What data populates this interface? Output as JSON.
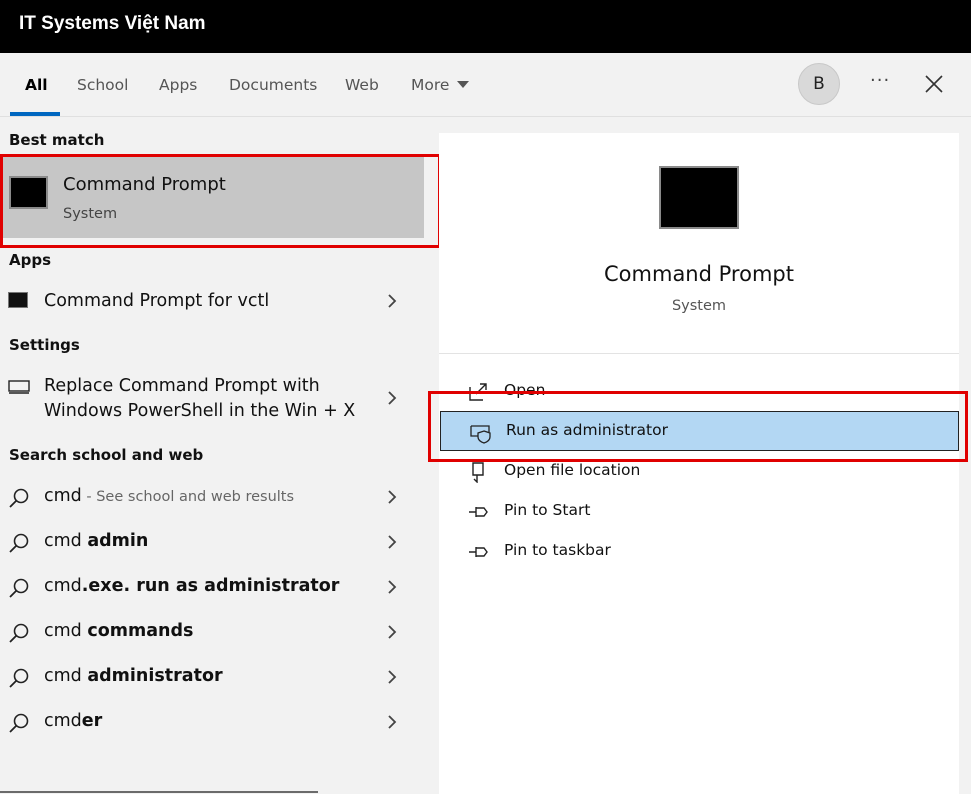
{
  "window": {
    "title": "IT Systems Việt Nam"
  },
  "tabs": [
    {
      "label": "All"
    },
    {
      "label": "School"
    },
    {
      "label": "Apps"
    },
    {
      "label": "Documents"
    },
    {
      "label": "Web"
    },
    {
      "label": "More"
    }
  ],
  "header": {
    "avatar_initial": "B",
    "more_dots": "···"
  },
  "left": {
    "best_match_heading": "Best match",
    "best_match": {
      "name": "Command Prompt",
      "type": "System"
    },
    "apps_heading": "Apps",
    "apps": [
      {
        "label": "Command Prompt for vctl"
      }
    ],
    "settings_heading": "Settings",
    "settings": [
      {
        "line1": "Replace Command Prompt with",
        "line2": "Windows PowerShell in the Win + X"
      }
    ],
    "web_heading": "Search school and web",
    "web_results": [
      {
        "prefix": "cmd",
        "bold": "",
        "suffix": " - See school and web results"
      },
      {
        "prefix": "cmd ",
        "bold": "admin",
        "suffix": ""
      },
      {
        "prefix": "cmd",
        "bold": ".exe. run as administrator",
        "suffix": ""
      },
      {
        "prefix": "cmd ",
        "bold": "commands",
        "suffix": ""
      },
      {
        "prefix": "cmd ",
        "bold": "administrator",
        "suffix": ""
      },
      {
        "prefix": "cmd",
        "bold": "er",
        "suffix": ""
      }
    ]
  },
  "preview": {
    "title": "Command Prompt",
    "subtitle": "System",
    "actions": [
      {
        "label": "Open",
        "icon": "open-icon"
      },
      {
        "label": "Run as administrator",
        "icon": "shield-icon"
      },
      {
        "label": "Open file location",
        "icon": "file-location-icon"
      },
      {
        "label": "Pin to Start",
        "icon": "pin-icon"
      },
      {
        "label": "Pin to taskbar",
        "icon": "pin-icon"
      }
    ]
  },
  "colors": {
    "accent": "#0067c0",
    "highlight_red": "#e00000",
    "selected_action": "#b3d7f3",
    "best_match_bg": "#c6c6c6"
  }
}
